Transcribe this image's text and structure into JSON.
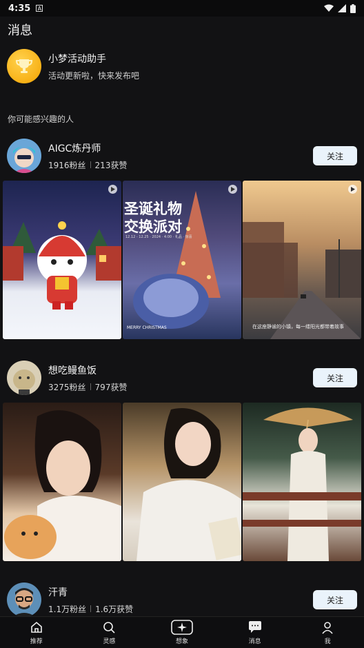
{
  "status_bar": {
    "time": "4:35",
    "app_icon_letter": "A"
  },
  "page_title": "消息",
  "assistant": {
    "name": "小梦活动助手",
    "subtitle": "活动更新啦，快来发布吧"
  },
  "section_label": "你可能感兴趣的人",
  "users": [
    {
      "name": "AIGC炼丹师",
      "fans": "1916粉丝",
      "likes": "213获赞",
      "follow_label": "关注",
      "tiles": [
        {
          "has_play": true
        },
        {
          "has_play": true,
          "title_line1": "圣诞礼物",
          "title_line2": "交换派对",
          "subtitle": "12.12 - 12.25 · 2024 · 4:00 · 礼品 · 惊喜",
          "footer": "MERRY CHRISTMAS"
        },
        {
          "has_play": true,
          "caption": "在这座静谧的小镇，每一缕阳光都带着故事"
        }
      ]
    },
    {
      "name": "想吃鳗鱼饭",
      "fans": "3275粉丝",
      "likes": "797获赞",
      "follow_label": "关注",
      "tiles": [
        {
          "has_play": false
        },
        {
          "has_play": false
        },
        {
          "has_play": false
        }
      ]
    },
    {
      "name": "汗青",
      "fans": "1.1万粉丝",
      "likes": "1.6万获赞",
      "follow_label": "关注"
    }
  ],
  "tabbar": [
    {
      "label": "推荐",
      "icon": "home-icon"
    },
    {
      "label": "灵感",
      "icon": "search-icon"
    },
    {
      "label": "想象",
      "icon": "sparkle-icon"
    },
    {
      "label": "消息",
      "icon": "message-icon",
      "active": true
    },
    {
      "label": "我",
      "icon": "profile-icon"
    }
  ]
}
